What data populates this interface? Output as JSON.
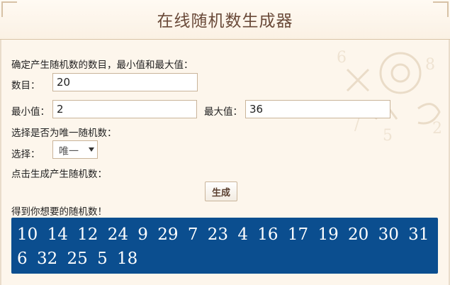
{
  "page": {
    "title": "在线随机数生成器"
  },
  "form": {
    "intro_label": "确定产生随机数的数目，最小值和最大值：",
    "count_label": "数目：",
    "count_value": "20",
    "min_label": "最小值：",
    "min_value": "2",
    "max_label": "最大值：",
    "max_value": "36",
    "unique_prompt": "选择是否为唯一随机数：",
    "select_label": "选择：",
    "select_value": "唯一",
    "generate_prompt": "点击生成产生随机数：",
    "generate_button": "生成",
    "result_label": "得到你想要的随机数！"
  },
  "result": {
    "numbers_text": "10 14 12 24 9 29 7 23 4 16 17 19 20 30 31 6 32 25 5 18"
  },
  "colors": {
    "background": "#fdf6ec",
    "title": "#6a4a39",
    "result_bg": "#0b4e8f",
    "border": "#c9b49a"
  },
  "icons": [
    "dropdown-arrow-icon",
    "decorative-math-symbols"
  ]
}
